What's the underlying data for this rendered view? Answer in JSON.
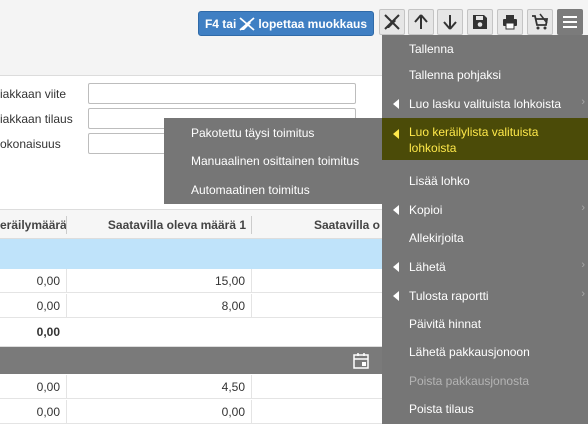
{
  "toolbar": {
    "edit_button_prefix": "F4 tai",
    "edit_button_suffix": "lopettaa muokkaus",
    "icons": [
      "no-edit-icon",
      "arrow-up-icon",
      "arrow-down-icon",
      "save-icon",
      "print-icon",
      "cart-icon",
      "menu-icon"
    ]
  },
  "form": {
    "customer_reference_label": "iakkaan viite",
    "customer_order_label": "iakkaan tilaus",
    "total_label": "okonaisuus",
    "customer_reference_value": "",
    "customer_order_value": "",
    "total_value": ""
  },
  "table": {
    "columns": [
      "eräilymäärä",
      "Saatavilla oleva määrä 1",
      "Saatavilla o"
    ],
    "rows": [
      {
        "col1": "0,00",
        "col2": "15,00",
        "col3": ""
      },
      {
        "col1": "0,00",
        "col2": "8,00",
        "col3": ""
      }
    ],
    "sum": "0,00",
    "rows_after": [
      {
        "col1": "0,00",
        "col2": "4,50",
        "col3": ""
      },
      {
        "col1": "0,00",
        "col2": "0,00",
        "col3": ""
      }
    ]
  },
  "menu": {
    "items": [
      {
        "label": "Tallenna",
        "submenu": false,
        "disabled": false
      },
      {
        "label": "Tallenna pohjaksi",
        "submenu": false,
        "disabled": false
      },
      {
        "label": "Luo lasku valituista lohkoista",
        "submenu": true,
        "disabled": false
      },
      {
        "label": "Luo keräilylista valituista lohkoista",
        "submenu": true,
        "disabled": false,
        "active": true
      },
      {
        "label": "Lisää lohko",
        "submenu": false,
        "disabled": false
      },
      {
        "label": "Kopioi",
        "submenu": true,
        "disabled": false
      },
      {
        "label": "Allekirjoita",
        "submenu": false,
        "disabled": false
      },
      {
        "label": "Lähetä",
        "submenu": true,
        "disabled": false
      },
      {
        "label": "Tulosta raportti",
        "submenu": true,
        "disabled": false
      },
      {
        "label": "Päivitä hinnat",
        "submenu": false,
        "disabled": false
      },
      {
        "label": "Lähetä pakkausjonoon",
        "submenu": false,
        "disabled": false
      },
      {
        "label": "Poista pakkausjonosta",
        "submenu": false,
        "disabled": true
      },
      {
        "label": "Poista tilaus",
        "submenu": false,
        "disabled": false
      }
    ],
    "submenu_items": [
      {
        "label": "Pakotettu täysi toimitus"
      },
      {
        "label": "Manuaalinen osittainen toimitus"
      },
      {
        "label": "Automaatinen toimitus"
      }
    ]
  },
  "colors": {
    "accent_button": "#3f7fc3",
    "menu_background": "#767676",
    "menu_active_background": "#4b4b08",
    "menu_active_text": "#ffe94a",
    "group_row": "#bfe3fa"
  }
}
